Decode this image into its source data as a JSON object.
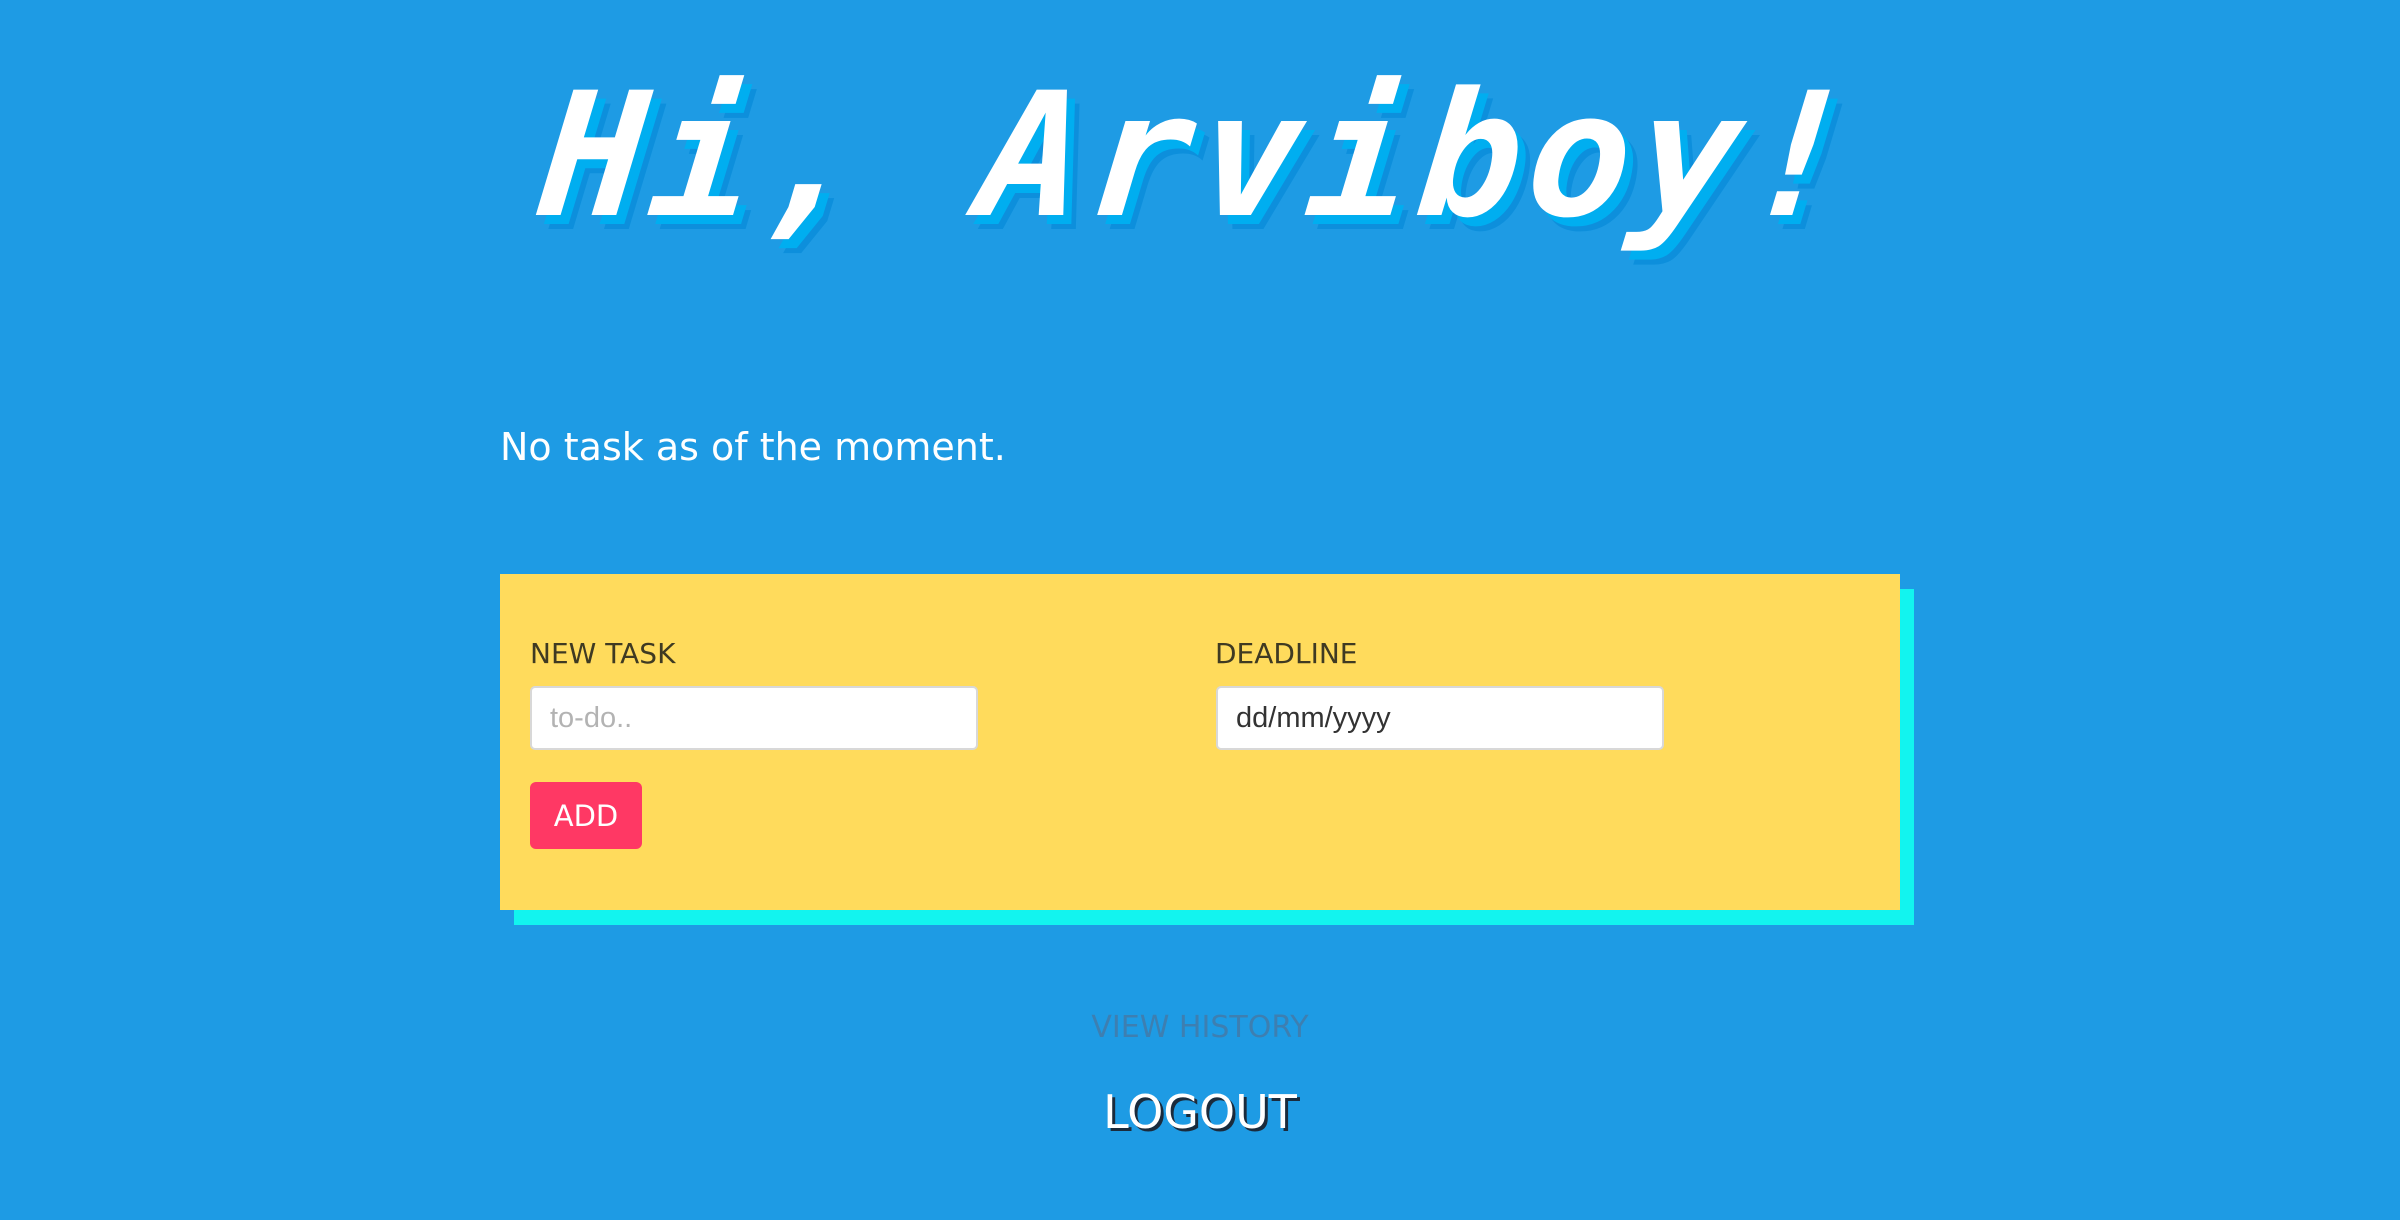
{
  "header": {
    "greeting": "Hi, Arviboy!"
  },
  "tasks": {
    "empty_message": "No task as of the moment."
  },
  "form": {
    "task_label": "NEW TASK",
    "task_placeholder": "to-do..",
    "task_value": "",
    "deadline_label": "DEADLINE",
    "deadline_display": "dd/mm/yyyy",
    "add_label": "ADD"
  },
  "footer": {
    "history_label": "VIEW HISTORY",
    "logout_label": "LOGOUT"
  },
  "colors": {
    "background": "#1e9be4",
    "card": "#ffdb5c",
    "card_shadow": "#12f4ef",
    "add_button": "#ff3864"
  }
}
